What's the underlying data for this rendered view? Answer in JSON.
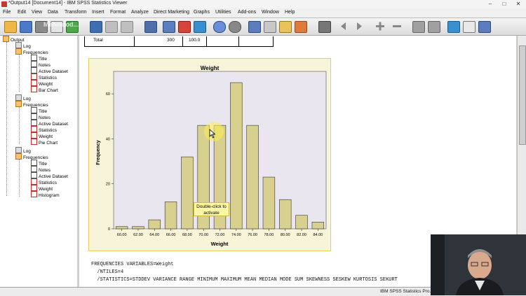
{
  "window": {
    "title": "*Output14 [Document14] - IBM SPSS Statistics Viewer",
    "min": "–",
    "max": "□",
    "close": "✕"
  },
  "menu": [
    "File",
    "Edit",
    "View",
    "Data",
    "Transform",
    "Insert",
    "Format",
    "Analyze",
    "Direct Marketing",
    "Graphs",
    "Utilities",
    "Add-ons",
    "Window",
    "Help"
  ],
  "watermark": {
    "line1": "Mahmood...",
    "line2": "..."
  },
  "tree": {
    "root": "Output",
    "groups": [
      {
        "log": "Log",
        "title": "Frequencies",
        "items": [
          "Title",
          "Notes",
          "Active Dataset",
          "Statistics",
          "Weight",
          "Bar Chart"
        ]
      },
      {
        "log": "Log",
        "title": "Frequencies",
        "items": [
          "Title",
          "Notes",
          "Active Dataset",
          "Statistics",
          "Weight",
          "Pie Chart"
        ]
      },
      {
        "log": "Log",
        "title": "Frequencies",
        "items": [
          "Title",
          "Notes",
          "Active Dataset",
          "Statistics",
          "Weight",
          "Histogram"
        ]
      }
    ]
  },
  "table": {
    "label": "Total",
    "count": "300",
    "percent": "100.0"
  },
  "chart_data": {
    "type": "bar",
    "title": "Weight",
    "xlabel": "Weight",
    "ylabel": "Frequency",
    "categories": [
      "60.00",
      "62.00",
      "64.00",
      "66.00",
      "68.00",
      "70.00",
      "72.00",
      "74.00",
      "76.00",
      "78.00",
      "80.00",
      "82.00",
      "84.00"
    ],
    "values": [
      1,
      1,
      4,
      12,
      32,
      46,
      46,
      65,
      46,
      23,
      13,
      6,
      3
    ],
    "ylim": [
      0,
      70
    ],
    "yticks": [
      0,
      20,
      40,
      60
    ],
    "bar_color": "#d8d08f",
    "plot_bg": "#e9e6ef",
    "grid": false
  },
  "tooltip": {
    "line1": "Double-click to",
    "line2": "activate"
  },
  "syntax": [
    "FREQUENCIES VARIABLES=Weight",
    "  /NTILES=4",
    "  /STATISTICS=STDDEV VARIANCE RANGE MINIMUM MAXIMUM MEAN MEDIAN MODE SUM SKEWNESS SESKEW KURTOSIS SEKURT"
  ],
  "status": "IBM SPSS Statistics Pro..."
}
